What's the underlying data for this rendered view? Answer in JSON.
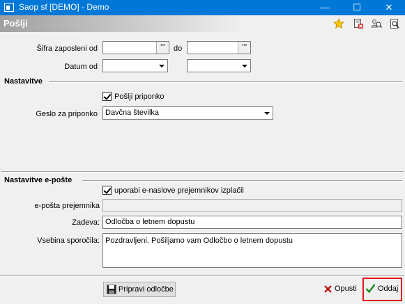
{
  "window": {
    "title": "Saop sf [DEMO] - Demo",
    "minimize_glyph": "—",
    "maximize_glyph": "☐",
    "close_glyph": "✕"
  },
  "section": {
    "title": "Pošlji",
    "toolbar_icons": [
      "star-icon",
      "delete-document-icon",
      "users-search-icon",
      "print-preview-icon"
    ]
  },
  "filters": {
    "employee_label": "Šifra zaposleni od",
    "employee_from": "",
    "employee_to_label": "do",
    "employee_to": "",
    "date_label": "Datum od",
    "date_from": "",
    "date_to": "",
    "browse_glyph": "···"
  },
  "settings": {
    "heading": "Nastavitve",
    "send_attachment_label": "Pošlji priponko",
    "send_attachment_checked": true,
    "password_label": "Geslo za priponko",
    "password_value": "Davčna številka"
  },
  "email_settings": {
    "heading": "Nastavitve e-pošte",
    "use_payee_emails_label": "uporabi e-naslove prejemnikov izplačil",
    "use_payee_emails_checked": true,
    "recipient_label": "e-pošta prejemnika",
    "recipient_value": "",
    "subject_label": "Zadeva:",
    "subject_value": "Odločba o letnem dopustu",
    "body_label": "Vsebina sporočila:",
    "body_value": "Pozdravljeni. Pošiljamo vam Odločbo o letnem dopustu"
  },
  "footer": {
    "prepare_label": "Pripravi odločbe",
    "cancel_label": "Opusti",
    "submit_label": "Oddaj"
  },
  "colors": {
    "titlebar": "#0078d7",
    "highlight_frame": "#e0161b",
    "check_green": "#1a8a1a",
    "cancel_red": "#c00000"
  }
}
